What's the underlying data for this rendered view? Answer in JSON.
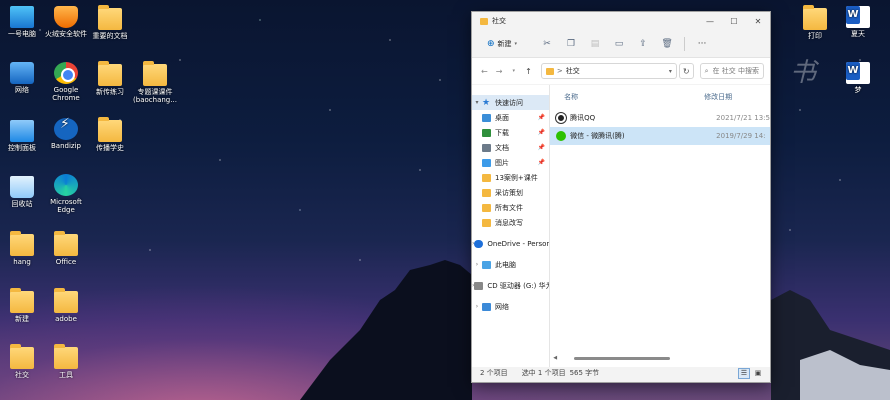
{
  "desktop": {
    "icons": [
      {
        "label": "一号电脑",
        "icon": "computer-icon"
      },
      {
        "label": "火绒安全软件",
        "icon": "shield-icon"
      },
      {
        "label": "重要的文档",
        "icon": "folder-icon"
      },
      {
        "label": "网络",
        "icon": "network-icon"
      },
      {
        "label": "Google Chrome",
        "icon": "chrome-icon"
      },
      {
        "label": "新传练习",
        "icon": "folder-icon"
      },
      {
        "label": "专题课课件 (baochang...",
        "icon": "folder-icon"
      },
      {
        "label": "控制面板",
        "icon": "control-panel-icon"
      },
      {
        "label": "Bandizip",
        "icon": "bandizip-icon"
      },
      {
        "label": "传播学史",
        "icon": "folder-icon"
      },
      {
        "label": "回收站",
        "icon": "recycle-bin-icon"
      },
      {
        "label": "Microsoft Edge",
        "icon": "edge-icon"
      },
      {
        "label": "hang",
        "icon": "folder-icon"
      },
      {
        "label": "Office",
        "icon": "folder-icon"
      },
      {
        "label": "新建",
        "icon": "folder-icon"
      },
      {
        "label": "adobe",
        "icon": "folder-icon"
      },
      {
        "label": "社交",
        "icon": "folder-icon"
      },
      {
        "label": "工具",
        "icon": "folder-icon"
      },
      {
        "label": "打印",
        "icon": "folder-icon"
      },
      {
        "label": "夏天",
        "icon": "word-icon"
      },
      {
        "label": "梦",
        "icon": "word-icon"
      }
    ]
  },
  "explorer": {
    "title": "社交",
    "toolbar": {
      "new_label": "新建",
      "more_label": "···"
    },
    "address": {
      "path_sep": ">",
      "path": "社交"
    },
    "search": {
      "placeholder": "在 社交 中搜索"
    },
    "nav": {
      "quick_access": "快速访问",
      "pinned": [
        {
          "label": "桌面"
        },
        {
          "label": "下载"
        },
        {
          "label": "文档"
        },
        {
          "label": "图片"
        }
      ],
      "recent": [
        {
          "label": "13案例+课件"
        },
        {
          "label": "采访策划"
        },
        {
          "label": "所有文件"
        },
        {
          "label": "消息改写"
        }
      ],
      "onedrive": "OneDrive - Persona",
      "this_pc": "此电脑",
      "cd_drive": "CD 驱动器 (G:) 华为",
      "network": "网络"
    },
    "columns": {
      "name": "名称",
      "modified": "修改日期"
    },
    "files": [
      {
        "name": "腾讯QQ",
        "date": "2021/7/21 13:5"
      },
      {
        "name": "微信 - 微腾讯(腾)",
        "date": "2019/7/29 14:"
      }
    ],
    "status": {
      "count": "2 个项目",
      "selection": "选中 1 个项目",
      "size": "565 字节"
    }
  },
  "colors": {
    "accent": "#0067c0",
    "selection": "#cce4f7"
  }
}
